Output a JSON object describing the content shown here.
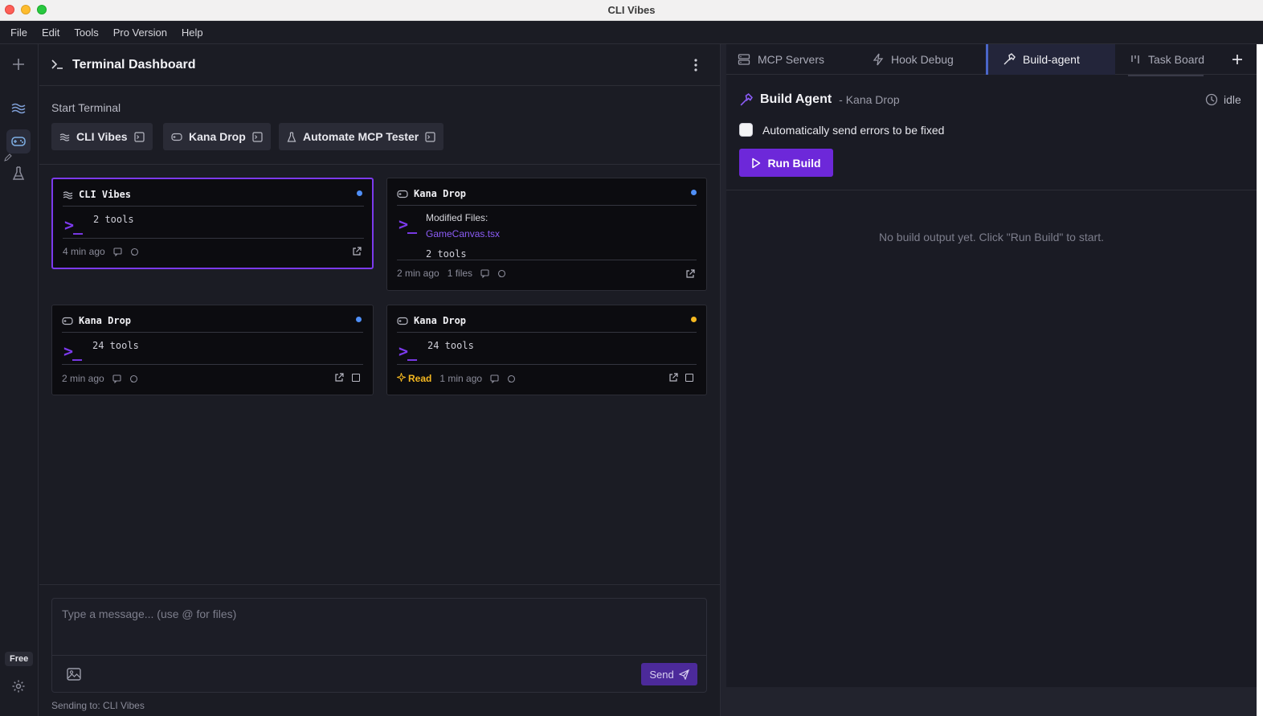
{
  "window": {
    "title": "CLI Vibes"
  },
  "menu": [
    "File",
    "Edit",
    "Tools",
    "Pro Version",
    "Help"
  ],
  "rail": {
    "badge": "Free"
  },
  "dashboard": {
    "title": "Terminal Dashboard",
    "start_label": "Start Terminal",
    "start_buttons": [
      "CLI Vibes",
      "Kana Drop",
      "Automate MCP Tester"
    ]
  },
  "cards": [
    {
      "title": "CLI Vibes",
      "tools": "2 tools",
      "time": "4 min ago",
      "dot_color": "#4f8ff7"
    },
    {
      "title": "Kana Drop",
      "modified_label": "Modified Files:",
      "modified_file": "GameCanvas.tsx",
      "tools": "2 tools",
      "time": "2 min ago",
      "files": "1 files",
      "dot_color": "#4f8ff7"
    },
    {
      "title": "Kana Drop",
      "tools": "24 tools",
      "time": "2 min ago",
      "dot_color": "#4f8ff7"
    },
    {
      "title": "Kana Drop",
      "tools": "24 tools",
      "badge": "Read",
      "time": "1 min ago",
      "dot_color": "#f5b820"
    }
  ],
  "composer": {
    "placeholder": "Type a message... (use @ for files)",
    "send_label": "Send",
    "sending_to": "Sending to: CLI Vibes"
  },
  "right_tabs": [
    "MCP Servers",
    "Hook Debug",
    "Build-agent",
    "Task Board"
  ],
  "build_agent": {
    "title": "Build Agent",
    "project": "- Kana Drop",
    "status": "idle",
    "auto_fix_label": "Automatically send errors to be fixed",
    "run_label": "Run Build",
    "empty_message": "No build output yet. Click \"Run Build\" to start."
  },
  "colors": {
    "accent": "#7c3aed",
    "status_blue": "#4f8ff7",
    "status_amber": "#f5b820"
  }
}
